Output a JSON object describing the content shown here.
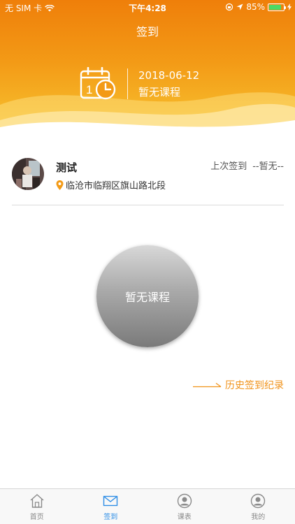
{
  "status_bar": {
    "carrier": "无 SIM 卡",
    "time": "下午4:28",
    "battery": "85%",
    "battery_level": 0.85
  },
  "nav": {
    "title": "签到"
  },
  "header": {
    "date": "2018-06-12",
    "course_status": "暂无课程",
    "icon": "calendar-clock-icon"
  },
  "user": {
    "name": "测试",
    "location": "临沧市临翔区旗山路北段",
    "last_sign_label": "上次签到",
    "last_sign_value": "--暂无--"
  },
  "sign_button": {
    "label": "暂无课程"
  },
  "history_link": {
    "label": "历史签到纪录"
  },
  "tabs": [
    {
      "label": "首页",
      "icon": "home-icon",
      "active": false
    },
    {
      "label": "签到",
      "icon": "envelope-icon",
      "active": true
    },
    {
      "label": "课表",
      "icon": "user-circle-icon",
      "active": false
    },
    {
      "label": "我的",
      "icon": "user-circle-icon",
      "active": false
    }
  ],
  "colors": {
    "header_orange": "#ef7f0a",
    "accent_orange": "#f09219",
    "tab_active": "#2e8ee6"
  }
}
